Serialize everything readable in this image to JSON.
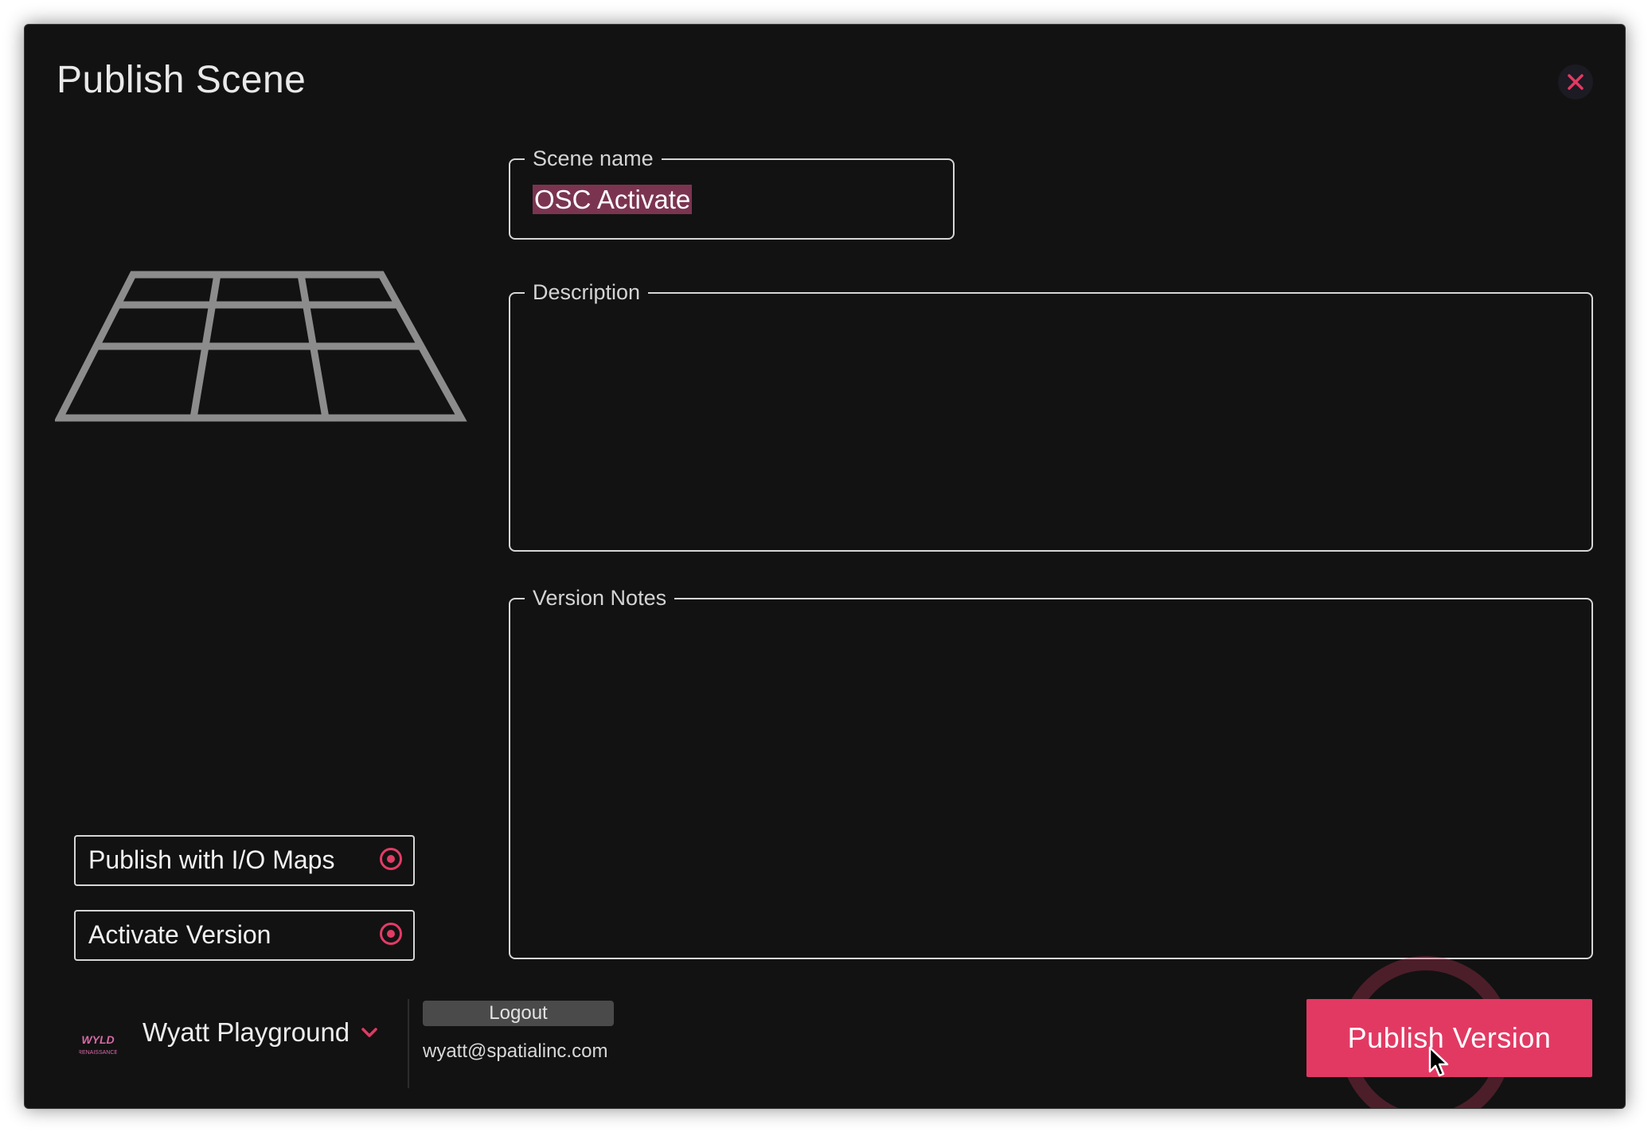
{
  "dialog": {
    "title": "Publish Scene",
    "close_icon": "close-icon",
    "accent_color": "#e23963"
  },
  "preview": {
    "icon": "grid-floor-icon"
  },
  "form": {
    "scene_name": {
      "label": "Scene name",
      "value": "OSC Activate"
    },
    "description": {
      "label": "Description",
      "value": ""
    },
    "version_notes": {
      "label": "Version Notes",
      "value": ""
    }
  },
  "toggles": [
    {
      "label": "Publish with I/O Maps",
      "icon": "radio-selected-icon"
    },
    {
      "label": "Activate Version",
      "icon": "radio-selected-icon"
    }
  ],
  "footer": {
    "logo_text": "WYLD RENAISSANCE",
    "workspace_name": "Wyatt Playground",
    "workspace_icon": "chevron-down-icon",
    "logout_label": "Logout",
    "user_email": "wyatt@spatialinc.com",
    "publish_label": "Publish Version"
  }
}
